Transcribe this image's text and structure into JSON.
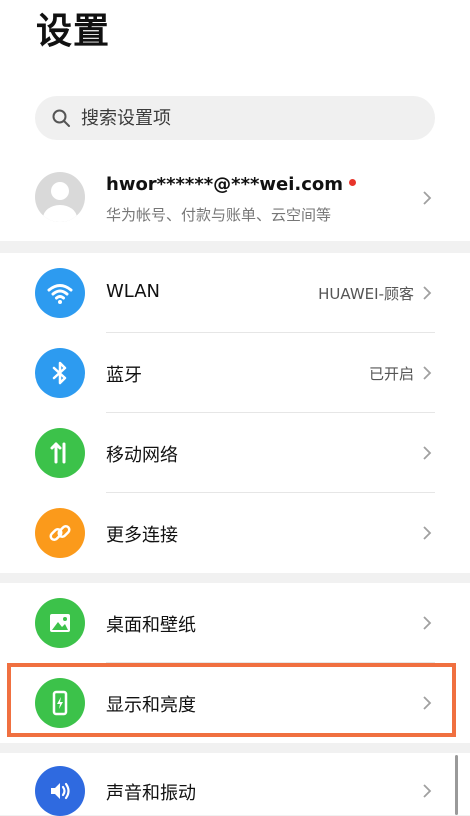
{
  "page": {
    "title": "设置"
  },
  "search": {
    "placeholder": "搜索设置项"
  },
  "account": {
    "name": "hwor******@***wei.com",
    "subtitle": "华为帐号、付款与账单、云空间等",
    "has_notification": true
  },
  "groups": [
    {
      "items": [
        {
          "label": "WLAN",
          "value": "HUAWEI-顾客",
          "icon": "wifi-icon",
          "color": "#2d9bf0"
        },
        {
          "label": "蓝牙",
          "value": "已开启",
          "icon": "bluetooth-icon",
          "color": "#2d9bf0"
        },
        {
          "label": "移动网络",
          "value": "",
          "icon": "mobile-data-icon",
          "color": "#3cc24a"
        },
        {
          "label": "更多连接",
          "value": "",
          "icon": "link-icon",
          "color": "#fb9a1b"
        }
      ]
    },
    {
      "items": [
        {
          "label": "桌面和壁纸",
          "value": "",
          "icon": "wallpaper-icon",
          "color": "#3cc24a"
        },
        {
          "label": "显示和亮度",
          "value": "",
          "icon": "display-brightness-icon",
          "color": "#3cc24a",
          "highlighted": true
        }
      ]
    },
    {
      "items": [
        {
          "label": "声音和振动",
          "value": "",
          "icon": "sound-icon",
          "color": "#2f6ae0"
        }
      ]
    }
  ],
  "colors": {
    "highlight_border": "#f07040",
    "notification_dot": "#e8352b"
  }
}
